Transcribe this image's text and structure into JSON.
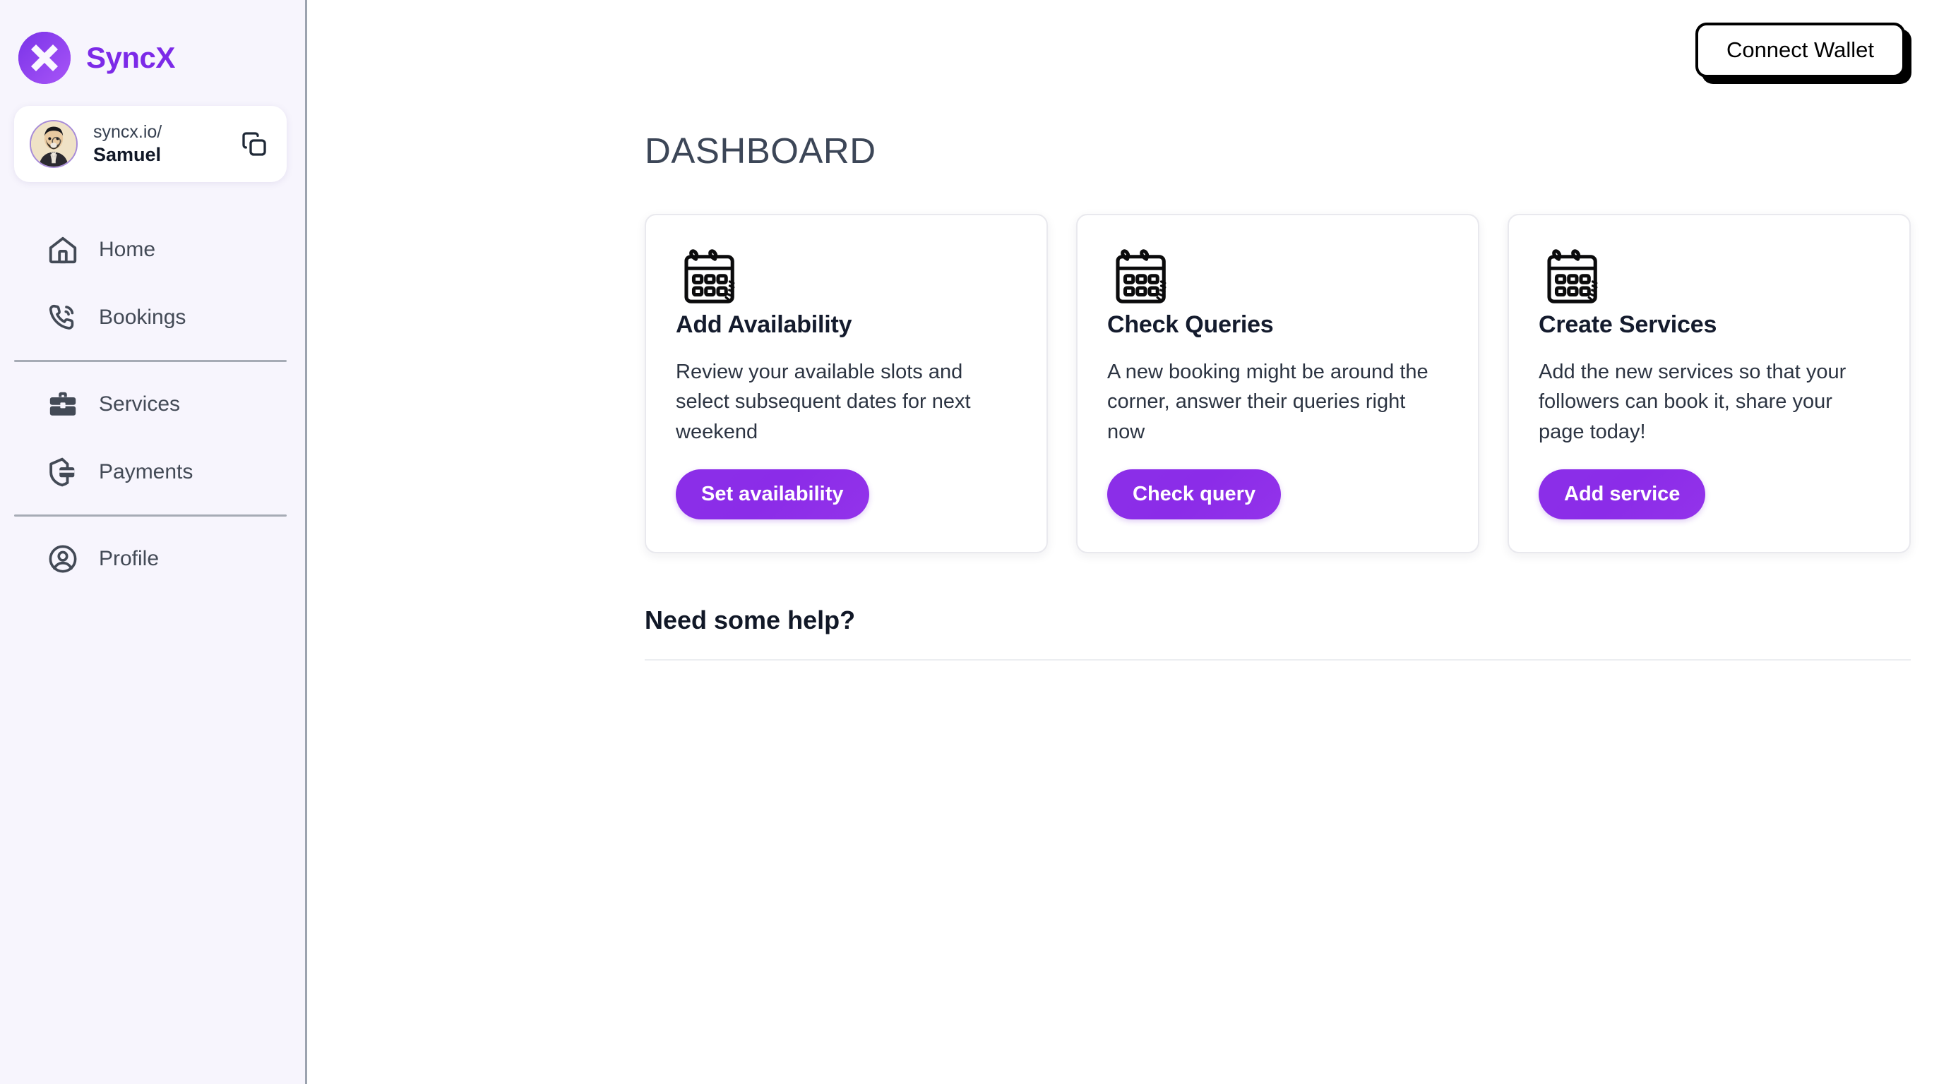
{
  "app": {
    "brand_name": "SyncX",
    "logo_icon": "syncx-x-logo-icon",
    "accent_color": "#8b2ce8",
    "sidebar_bg": "#f7f5fd",
    "text_color": "#434a56"
  },
  "sidebar": {
    "profile": {
      "url": "syncx.io/",
      "handle": "Samuel",
      "avatar_icon": "user-avatar-portrait",
      "copy_icon": "copy-icon"
    },
    "groups": [
      {
        "items": [
          {
            "label": "Home",
            "icon": "home-icon"
          },
          {
            "label": "Bookings",
            "icon": "phone-call-icon"
          }
        ]
      },
      {
        "items": [
          {
            "label": "Services",
            "icon": "briefcase-icon"
          },
          {
            "label": "Payments",
            "icon": "shield-card-icon"
          }
        ]
      },
      {
        "items": [
          {
            "label": "Profile",
            "icon": "user-circle-icon"
          }
        ]
      }
    ]
  },
  "topbar": {
    "connect_wallet_label": "Connect Wallet"
  },
  "main": {
    "page_title": "DASHBOARD",
    "cards": [
      {
        "icon": "calendar-icon",
        "title": "Add Availability",
        "description": "Review your available slots and select subsequent dates for next weekend",
        "button_label": "Set availability"
      },
      {
        "icon": "calendar-icon",
        "title": "Check Queries",
        "description": "A new booking might be around the corner, answer their queries right now",
        "button_label": "Check query"
      },
      {
        "icon": "calendar-icon",
        "title": "Create Services",
        "description": "Add the new services so that your followers can book it, share your page today!",
        "button_label": "Add service"
      }
    ],
    "help": {
      "title": "Need some help?"
    }
  }
}
